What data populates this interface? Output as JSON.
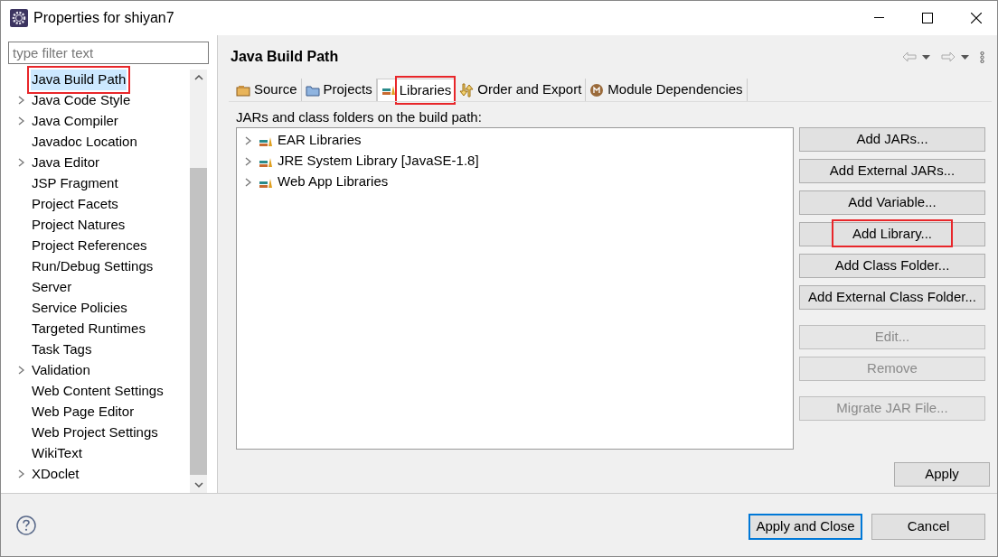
{
  "window": {
    "title": "Properties for shiyan7"
  },
  "filter": {
    "placeholder": "type filter text"
  },
  "sidebar": {
    "items": [
      {
        "label": "Java Build Path",
        "expandable": false,
        "selected": true,
        "marked": true
      },
      {
        "label": "Java Code Style",
        "expandable": true,
        "selected": false,
        "marked": false
      },
      {
        "label": "Java Compiler",
        "expandable": true,
        "selected": false,
        "marked": false
      },
      {
        "label": "Javadoc Location",
        "expandable": false,
        "selected": false,
        "marked": false
      },
      {
        "label": "Java Editor",
        "expandable": true,
        "selected": false,
        "marked": false
      },
      {
        "label": "JSP Fragment",
        "expandable": false,
        "selected": false,
        "marked": false
      },
      {
        "label": "Project Facets",
        "expandable": false,
        "selected": false,
        "marked": false
      },
      {
        "label": "Project Natures",
        "expandable": false,
        "selected": false,
        "marked": false
      },
      {
        "label": "Project References",
        "expandable": false,
        "selected": false,
        "marked": false
      },
      {
        "label": "Run/Debug Settings",
        "expandable": false,
        "selected": false,
        "marked": false
      },
      {
        "label": "Server",
        "expandable": false,
        "selected": false,
        "marked": false
      },
      {
        "label": "Service Policies",
        "expandable": false,
        "selected": false,
        "marked": false
      },
      {
        "label": "Targeted Runtimes",
        "expandable": false,
        "selected": false,
        "marked": false
      },
      {
        "label": "Task Tags",
        "expandable": false,
        "selected": false,
        "marked": false
      },
      {
        "label": "Validation",
        "expandable": true,
        "selected": false,
        "marked": false
      },
      {
        "label": "Web Content Settings",
        "expandable": false,
        "selected": false,
        "marked": false
      },
      {
        "label": "Web Page Editor",
        "expandable": false,
        "selected": false,
        "marked": false
      },
      {
        "label": "Web Project Settings",
        "expandable": false,
        "selected": false,
        "marked": false
      },
      {
        "label": "WikiText",
        "expandable": false,
        "selected": false,
        "marked": false
      },
      {
        "label": "XDoclet",
        "expandable": true,
        "selected": false,
        "marked": false
      }
    ]
  },
  "page": {
    "title": "Java Build Path",
    "tabs": [
      {
        "label": "Source",
        "kind": "source",
        "selected": false,
        "marked": false
      },
      {
        "label": "Projects",
        "kind": "projects",
        "selected": false,
        "marked": false
      },
      {
        "label": "Libraries",
        "kind": "libraries",
        "selected": true,
        "marked": true
      },
      {
        "label": "Order and Export",
        "kind": "order",
        "selected": false,
        "marked": false
      },
      {
        "label": "Module Dependencies",
        "kind": "module",
        "selected": false,
        "marked": false
      }
    ],
    "list_label": "JARs and class folders on the build path:",
    "libraries": [
      {
        "label": "EAR Libraries"
      },
      {
        "label": "JRE System Library [JavaSE-1.8]"
      },
      {
        "label": "Web App Libraries"
      }
    ],
    "button_groups": [
      [
        {
          "label": "Add JARs...",
          "disabled": false,
          "marked": false
        },
        {
          "label": "Add External JARs...",
          "disabled": false,
          "marked": false
        },
        {
          "label": "Add Variable...",
          "disabled": false,
          "marked": false
        },
        {
          "label": "Add Library...",
          "disabled": false,
          "marked": true
        },
        {
          "label": "Add Class Folder...",
          "disabled": false,
          "marked": false
        },
        {
          "label": "Add External Class Folder...",
          "disabled": false,
          "marked": false
        }
      ],
      [
        {
          "label": "Edit...",
          "disabled": true,
          "marked": false
        },
        {
          "label": "Remove",
          "disabled": true,
          "marked": false
        }
      ],
      [
        {
          "label": "Migrate JAR File...",
          "disabled": true,
          "marked": false
        }
      ]
    ],
    "apply": "Apply"
  },
  "footer": {
    "buttons": [
      {
        "label": "Apply and Close",
        "default": true
      },
      {
        "label": "Cancel",
        "default": false
      }
    ]
  }
}
